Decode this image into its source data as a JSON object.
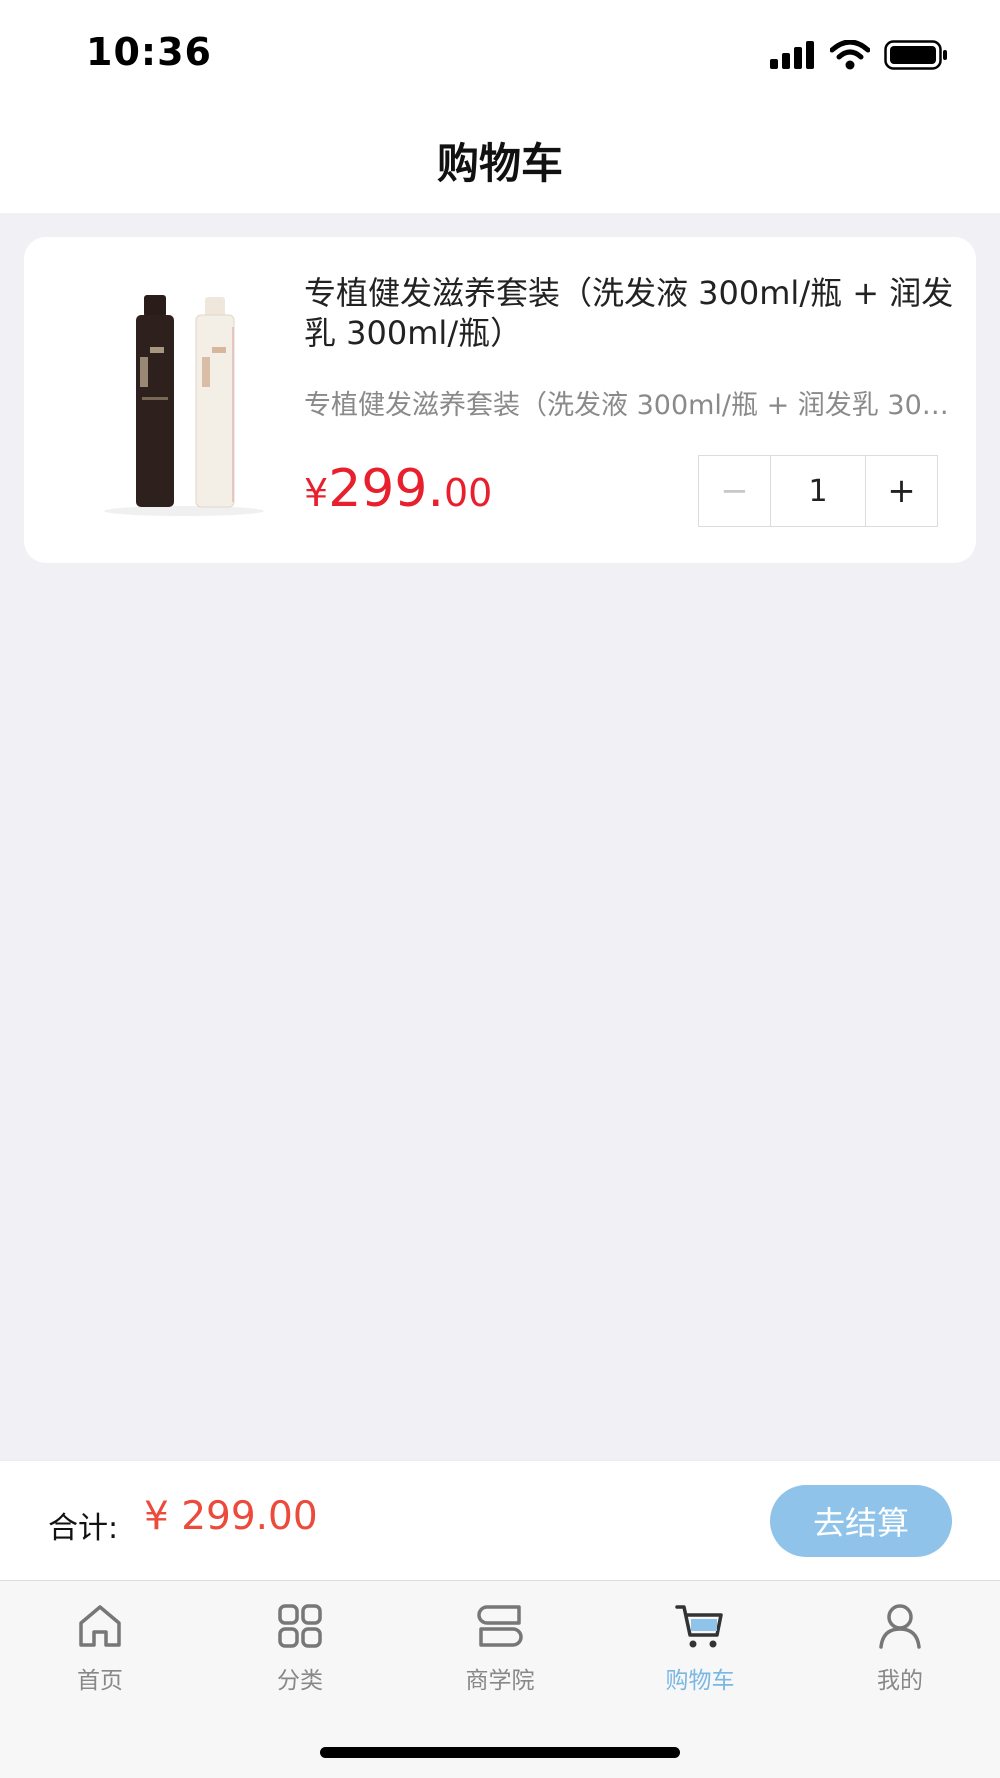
{
  "status_bar": {
    "time": "10:36"
  },
  "nav": {
    "title": "购物车"
  },
  "cart": {
    "items": [
      {
        "title": "专植健发滋养套装（洗发液 300ml/瓶 + 润发乳 300ml/瓶）",
        "subtitle": "专植健发滋养套装（洗发液 300ml/瓶 + 润发乳 300ml/瓶）",
        "price_symbol": "¥",
        "price_integer": "299.",
        "price_decimal": "00",
        "quantity": "1",
        "minus_label": "−",
        "plus_label": "+"
      }
    ]
  },
  "checkout": {
    "total_label": "合计:",
    "total_amount": "¥ 299.00",
    "button_label": "去结算"
  },
  "tabs": [
    {
      "label": "首页",
      "icon": "home-icon"
    },
    {
      "label": "分类",
      "icon": "grid-icon"
    },
    {
      "label": "商学院",
      "icon": "layers-icon"
    },
    {
      "label": "购物车",
      "icon": "cart-icon",
      "active": true
    },
    {
      "label": "我的",
      "icon": "user-icon"
    }
  ],
  "colors": {
    "price_red": "#e8202e",
    "total_red": "#ec4a3a",
    "accent_blue": "#8fc3ea",
    "active_tab": "#7ab8e4"
  }
}
